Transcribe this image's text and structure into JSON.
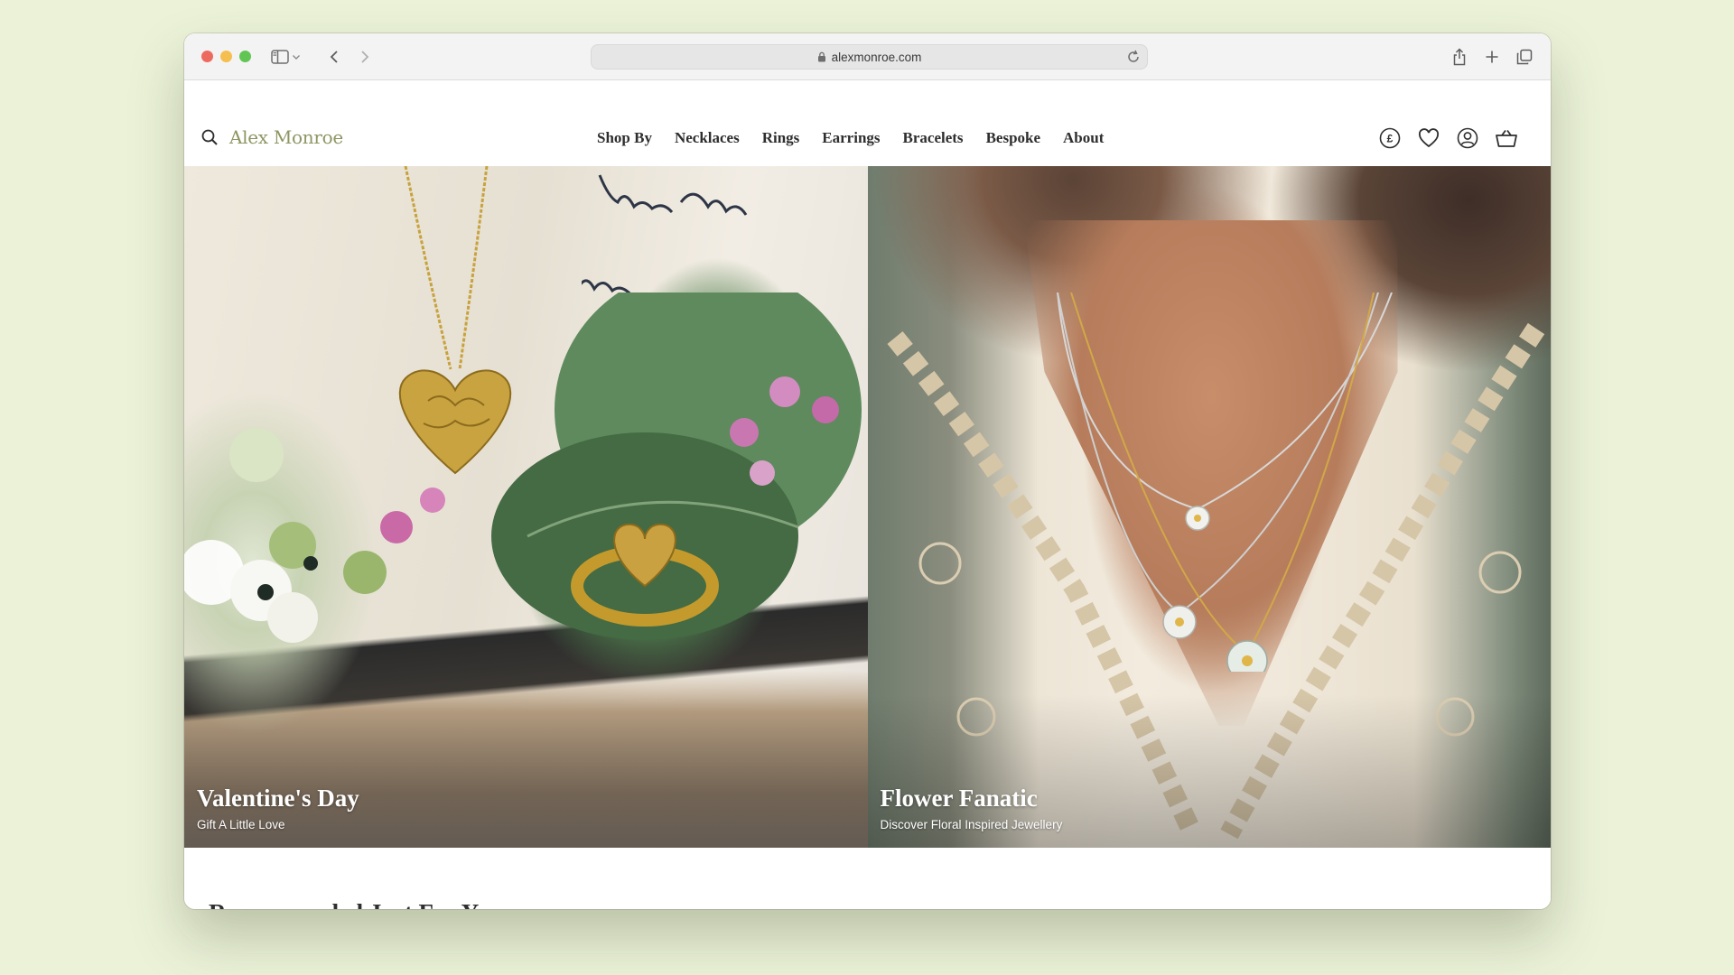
{
  "browser": {
    "url": "alexmonroe.com",
    "traffic_lights": {
      "close": "#ed6a5e",
      "minimize": "#f5bf4f",
      "maximize": "#61c554"
    }
  },
  "site": {
    "logo": "Alex Monroe",
    "logo_color": "#8d9662",
    "nav": [
      "Shop By",
      "Necklaces",
      "Rings",
      "Earrings",
      "Bracelets",
      "Bespoke",
      "About"
    ],
    "header_icons": [
      "currency-icon",
      "wishlist-icon",
      "account-icon",
      "basket-icon"
    ],
    "currency_symbol": "£"
  },
  "hero": [
    {
      "title": "Valentine's Day",
      "subtitle": "Gift A Little Love"
    },
    {
      "title": "Flower Fanatic",
      "subtitle": "Discover Floral Inspired Jewellery"
    }
  ],
  "section": {
    "title": "Recommended Just For You"
  }
}
